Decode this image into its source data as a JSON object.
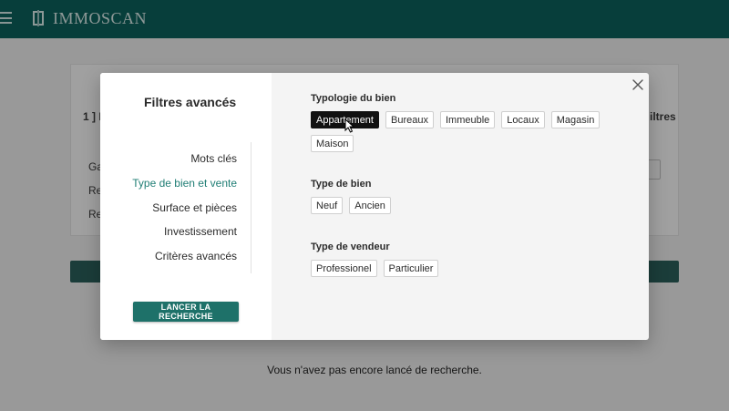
{
  "app": {
    "name": "IMMOSCAN"
  },
  "background": {
    "section_label": "1 ] I",
    "right_label": "iltres",
    "row_labels": [
      "Ga",
      "Re",
      "Re"
    ],
    "empty_message": "Vous n'avez pas encore lancé de recherche."
  },
  "modal": {
    "title": "Filtres avancés",
    "nav": [
      {
        "label": "Mots clés",
        "active": false
      },
      {
        "label": "Type de bien et vente",
        "active": true
      },
      {
        "label": "Surface et pièces",
        "active": false
      },
      {
        "label": "Investissement",
        "active": false
      },
      {
        "label": "Critères avancés",
        "active": false
      }
    ],
    "search_button": "LANCER LA RECHERCHE",
    "sections": [
      {
        "title": "Typologie du bien",
        "options": [
          "Appartement",
          "Bureaux",
          "Immeuble",
          "Locaux",
          "Magasin",
          "Maison"
        ],
        "selected": "Appartement"
      },
      {
        "title": "Type de bien",
        "options": [
          "Neuf",
          "Ancien"
        ],
        "selected": null
      },
      {
        "title": "Type de vendeur",
        "options": [
          "Professionel",
          "Particulier"
        ],
        "selected": null
      }
    ]
  },
  "colors": {
    "primary": "#0c5f5a",
    "button": "#1e7169",
    "active_nav": "#1f7d74",
    "selected_chip": "#111111"
  },
  "icons": {
    "menu": "hamburger-icon",
    "logo": "logo-icon",
    "close": "close-icon",
    "cursor": "cursor-icon"
  }
}
